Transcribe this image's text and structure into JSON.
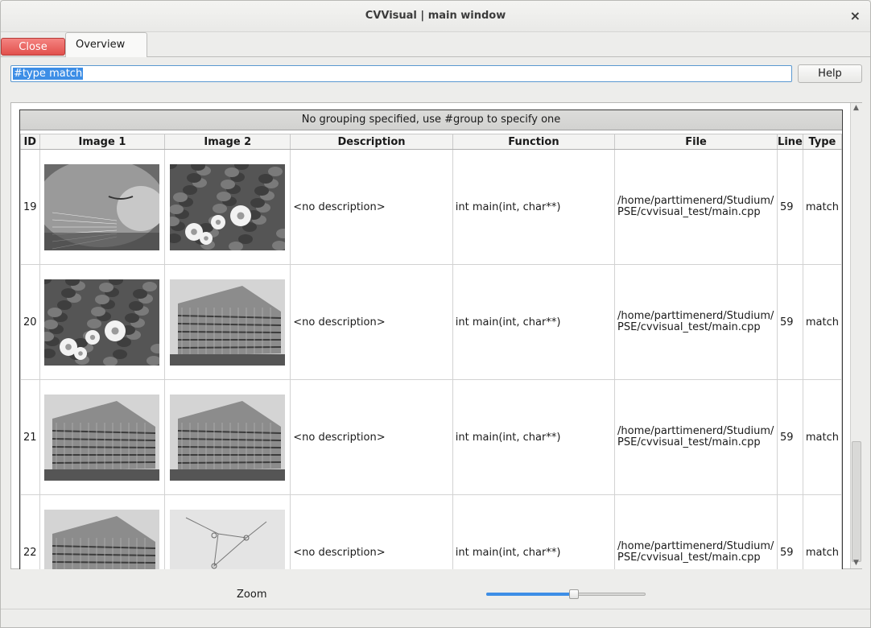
{
  "window": {
    "title": "CVVisual | main window",
    "close_glyph": "×"
  },
  "toolbar": {
    "close_label": "Close",
    "tab_overview": "Overview",
    "help_label": "Help"
  },
  "filter": {
    "value": "#type match"
  },
  "table": {
    "group_header": "No grouping specified, use #group to specify one",
    "columns": [
      "ID",
      "Image 1",
      "Image 2",
      "Description",
      "Function",
      "File",
      "Line",
      "Type"
    ],
    "rows": [
      {
        "id": "19",
        "image1": "cat-image",
        "image2": "flowers-image",
        "description": "<no description>",
        "function": "int main(int, char**)",
        "file_line1": "/home/parttimenerd/Studium/",
        "file_line2": "PSE/cvvisual_test/main.cpp",
        "line": "59",
        "type": "match"
      },
      {
        "id": "20",
        "image1": "flowers-image",
        "image2": "building-image",
        "description": "<no description>",
        "function": "int main(int, char**)",
        "file_line1": "/home/parttimenerd/Studium/",
        "file_line2": "PSE/cvvisual_test/main.cpp",
        "line": "59",
        "type": "match"
      },
      {
        "id": "21",
        "image1": "building-image",
        "image2": "building-image",
        "description": "<no description>",
        "function": "int main(int, char**)",
        "file_line1": "/home/parttimenerd/Studium/",
        "file_line2": "PSE/cvvisual_test/main.cpp",
        "line": "59",
        "type": "match"
      },
      {
        "id": "22",
        "image1": "building-image",
        "image2": "sketch-image",
        "description": "<no description>",
        "function": "int main(int, char**)",
        "file_line1": "/home/parttimenerd/Studium/",
        "file_line2": "PSE/cvvisual_test/main.cpp",
        "line": "59",
        "type": "match"
      }
    ]
  },
  "zoom": {
    "label": "Zoom",
    "level_fraction": 0.55
  },
  "colors": {
    "close_button": "#e2504c",
    "accent": "#3d8ee6",
    "slider_fill": "#3d8ee6"
  }
}
